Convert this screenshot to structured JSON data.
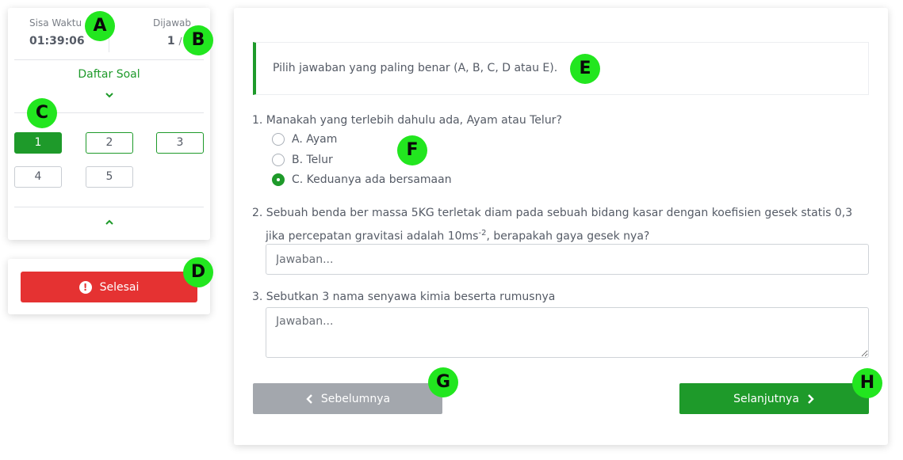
{
  "stats": {
    "time_label": "Sisa Waktu",
    "time_value": "01:39:06",
    "answered_label": "Dijawab",
    "answered_count": "1",
    "answered_total": "/ 5"
  },
  "question_list": {
    "title": "Daftar Soal",
    "items": [
      {
        "label": "1",
        "state": "active"
      },
      {
        "label": "2",
        "state": "answered"
      },
      {
        "label": "3",
        "state": "answered"
      },
      {
        "label": "4",
        "state": "unanswered"
      },
      {
        "label": "5",
        "state": "unanswered"
      }
    ]
  },
  "finish": {
    "label": "Selesai",
    "icon": "exclamation-circle-icon"
  },
  "instruction": "Pilih jawaban yang paling benar (A, B, C, D atau E).",
  "questions": [
    {
      "text": "1. Manakah yang terlebih dahulu ada, Ayam atau Telur?",
      "options": [
        "A. Ayam",
        "B. Telur",
        "C. Keduanya ada bersamaan"
      ],
      "selected": "C. Keduanya ada bersamaan"
    },
    {
      "text_line1": "2. Sebuah benda ber massa 5KG terletak diam pada sebuah bidang kasar dengan koefisien gesek statis 0,3",
      "text_line2_before": "jika percepatan gravitasi adalah 10ms",
      "text_line2_sup": "-2",
      "text_line2_after": ", berapakah gaya gesek nya?",
      "placeholder": "Jawaban..."
    },
    {
      "text": "3. Sebutkan 3 nama senyawa kimia beserta rumusnya",
      "placeholder": "Jawaban..."
    }
  ],
  "navigation": {
    "prev_label": "Sebelumnya",
    "next_label": "Selanjutnya"
  },
  "markers": [
    "A",
    "B",
    "C",
    "D",
    "E",
    "F",
    "G",
    "H"
  ],
  "colors": {
    "accent": "#1e9a2a",
    "danger": "#e53232",
    "disabled": "#a3a7ad",
    "marker": "#22e61f"
  }
}
